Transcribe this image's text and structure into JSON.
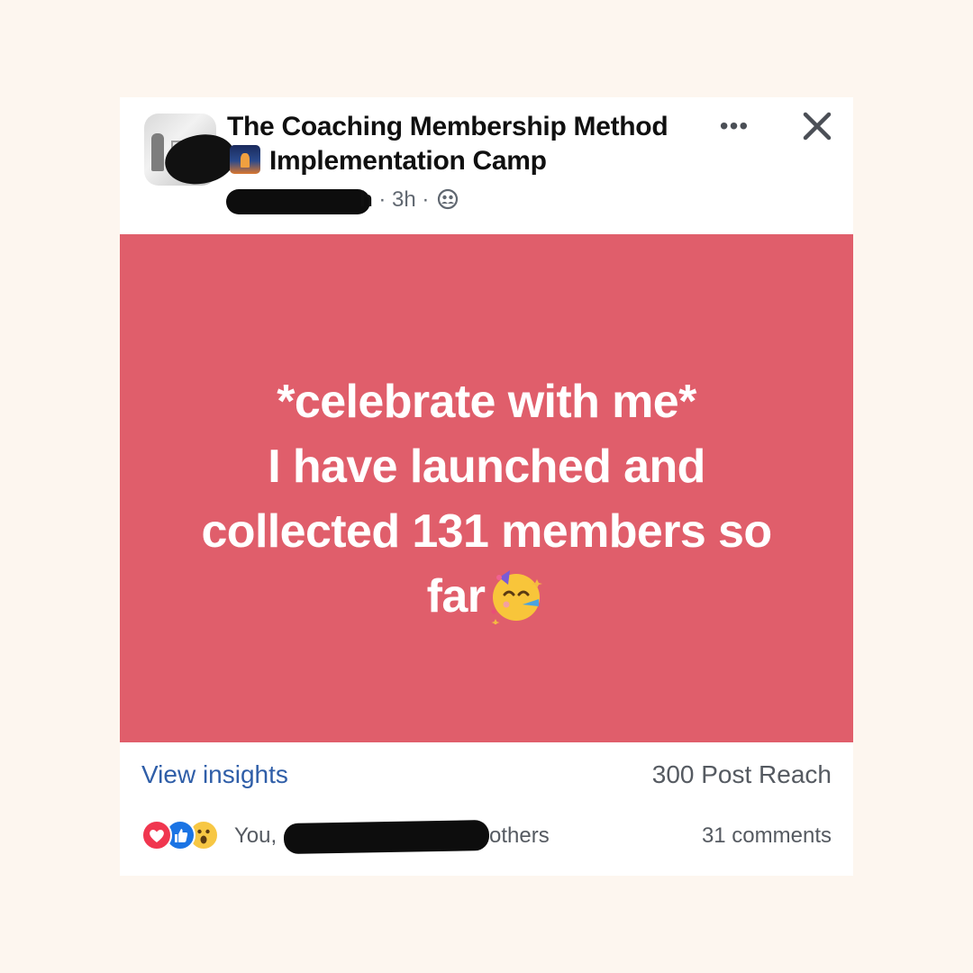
{
  "post": {
    "group_name_line1": "The Coaching Membership Method",
    "group_name_line2": "Implementation Camp",
    "author_visible_tail": "h",
    "time": "· 3h ·",
    "privacy_icon": "group-members-icon",
    "more_icon": "more-horizontal-icon",
    "more_label": "•••",
    "close_icon": "close-icon"
  },
  "banner": {
    "background_color": "#e05e6b",
    "line1": "*celebrate with me*",
    "line2": "I have launched and",
    "line3": "collected 131 members so",
    "line4": "far",
    "emoji": "partying-face-icon"
  },
  "insights": {
    "link_label": "View insights",
    "reach_label": "300 Post Reach"
  },
  "reactions": {
    "icons": [
      "love-reaction-icon",
      "like-reaction-icon",
      "wow-reaction-icon"
    ],
    "reactors_prefix": "You,",
    "reactors_suffix": "others",
    "comments_label": "31 comments"
  }
}
